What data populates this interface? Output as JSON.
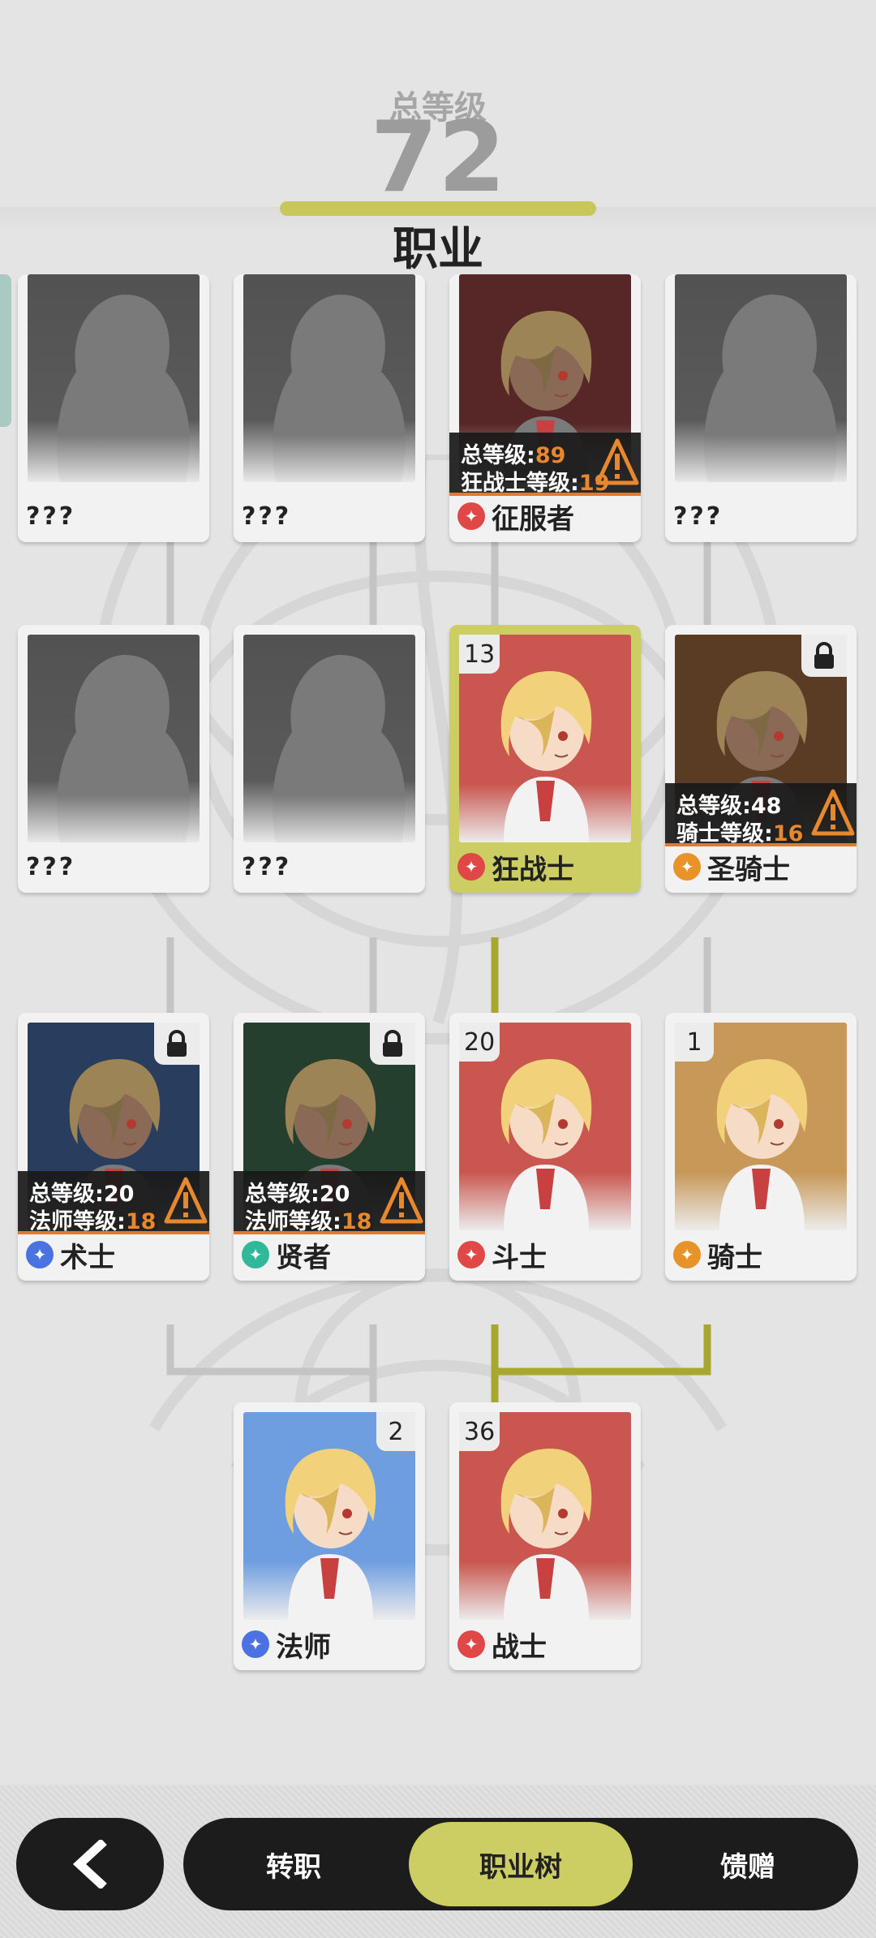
{
  "header": {
    "total_level_label": "总等级",
    "total_level_value": "72",
    "title": "职业"
  },
  "rows": [
    [
      {
        "name": "???",
        "locked_silhouette": true
      },
      {
        "name": "???",
        "locked_silhouette": true
      },
      {
        "name": "征服者",
        "icon": "conqueror-icon",
        "icon_color": "#e04848",
        "bg": "#6b3030",
        "requirement": {
          "total_label": "总等级:",
          "total_value": "89",
          "class_label": "狂战士等级:",
          "class_value": "19"
        }
      },
      {
        "name": "???",
        "locked_silhouette": true
      }
    ],
    [
      {
        "name": "???",
        "locked_silhouette": true
      },
      {
        "name": "???",
        "locked_silhouette": true
      },
      {
        "name": "狂战士",
        "icon": "berserker-icon",
        "icon_color": "#e04848",
        "bg": "#c9574f",
        "count": "13",
        "selected": true
      },
      {
        "name": "圣骑士",
        "icon": "paladin-icon",
        "icon_color": "#e8922a",
        "bg": "#6e4a2c",
        "locked": true,
        "requirement": {
          "total_label": "总等级:",
          "total_value": "48",
          "class_label": "骑士等级:",
          "class_value": "16"
        }
      }
    ],
    [
      {
        "name": "术士",
        "icon": "warlock-icon",
        "icon_color": "#4a72e0",
        "bg": "#334c73",
        "locked": true,
        "requirement": {
          "total_label": "总等级:",
          "total_value": "20",
          "class_label": "法师等级:",
          "class_value": "18"
        }
      },
      {
        "name": "贤者",
        "icon": "sage-icon",
        "icon_color": "#2fb89a",
        "bg": "#2e4d3a",
        "locked": true,
        "requirement": {
          "total_label": "总等级:",
          "total_value": "20",
          "class_label": "法师等级:",
          "class_value": "18"
        }
      },
      {
        "name": "斗士",
        "icon": "fighter-icon",
        "icon_color": "#e04848",
        "bg": "#c9574f",
        "count": "20"
      },
      {
        "name": "骑士",
        "icon": "knight-icon",
        "icon_color": "#e8922a",
        "bg": "#c79858",
        "count": "1"
      }
    ],
    [
      {
        "name": "法师",
        "icon": "mage-icon",
        "icon_color": "#4a72e0",
        "bg": "#6f9ee0",
        "count": "2"
      },
      {
        "name": "战士",
        "icon": "warrior-icon",
        "icon_color": "#e04848",
        "bg": "#c9574f",
        "count": "36"
      }
    ]
  ],
  "nav": {
    "back": "back-arrow-icon",
    "tabs": [
      "转职",
      "职业树",
      "馈赠"
    ],
    "active_tab": "职业树"
  },
  "colors": {
    "accent": "#cccd63",
    "warning": "#e8882e",
    "line_gray": "#c4c4c4",
    "line_active": "#a8a830"
  }
}
